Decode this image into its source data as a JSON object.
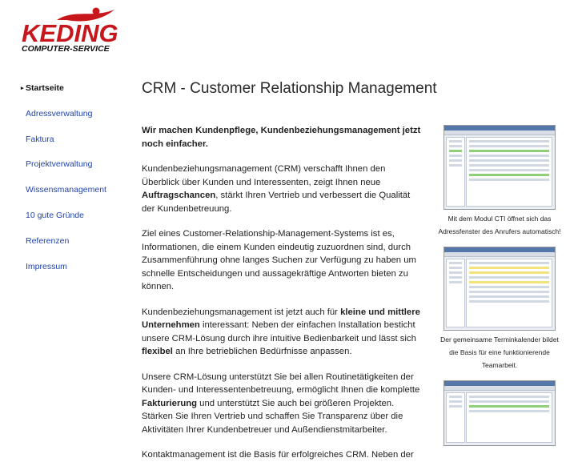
{
  "logo": {
    "brand": "KEDING",
    "tagline": "COMPUTER-SERVICE"
  },
  "nav": [
    {
      "label": "Startseite",
      "active": true
    },
    {
      "label": "Adressverwaltung"
    },
    {
      "label": "Faktura"
    },
    {
      "label": "Projektverwaltung"
    },
    {
      "label": "Wissensmanagement"
    },
    {
      "label": "10 gute Gründe"
    },
    {
      "label": "Referenzen"
    },
    {
      "label": "Impressum"
    }
  ],
  "title": "CRM - Customer Relationship Management",
  "lead": "Wir machen Kundenpflege, Kundenbeziehungsmanagement jetzt noch einfacher.",
  "paragraphs": [
    {
      "p1": "Kundenbeziehungsmanagement (CRM) verschafft Ihnen den Überblick über Kunden und Interessenten, zeigt Ihnen neue ",
      "b1": "Auftragschancen",
      "p2": ", stärkt Ihren Vertrieb und verbessert die Qualität der Kundenbetreuung."
    },
    {
      "p1": "Ziel eines Customer-Relationship-Management-Systems ist es, Informationen, die einem Kunden eindeutig zuzuordnen sind, durch Zusammenführung ohne langes Suchen zur Verfügung zu haben um schnelle Entscheidungen und aussagekräftige Antworten bieten zu können."
    },
    {
      "p1": "Kundenbeziehungsmanagement ist jetzt auch für ",
      "b1": "kleine und mittlere Unternehmen",
      "p2": " interessant: Neben der einfachen Installation besticht unsere CRM-Lösung durch ihre intuitive Bedienbarkeit und lässt sich ",
      "b2": "flexibel",
      "p3": " an Ihre betrieblichen Bedürfnisse anpassen."
    },
    {
      "p1": "Unsere CRM-Lösung unterstützt Sie bei allen Routinetätigkeiten der Kunden- und Interessentenbetreuung, ermöglicht Ihnen die komplette ",
      "b1": "Fakturierung",
      "p2": " und unterstützt Sie auch bei größeren Projekten. Stärken Sie Ihren Vertrieb und schaffen Sie Transparenz über die Aktivitäten Ihrer Kundenbetreuer und Außendienstmitarbeiter."
    },
    {
      "p1": "Kontaktmanagement ist die Basis für erfolgreiches CRM. Neben der"
    }
  ],
  "screenshots": [
    {
      "caption": "Mit dem Modul CTI öffnet sich das Adressfenster des Anrufers automatisch!"
    },
    {
      "caption": "Der gemeinsame Terminkalender bildet die Basis für eine funktionierende Teamarbeit."
    },
    {
      "caption": ""
    }
  ]
}
